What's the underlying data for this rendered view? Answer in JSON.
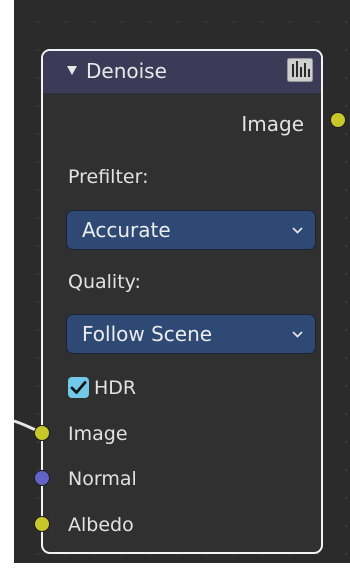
{
  "node": {
    "title": "Denoise",
    "collapse_icon": "triangle-down-icon",
    "preview_icon": "denoise-node-icon",
    "header_color": "#3b3a57",
    "border_color": "#f2f2f2",
    "outputs": [
      {
        "label": "Image",
        "socket_color": "#c7c729"
      }
    ],
    "prefilter": {
      "label": "Prefilter:",
      "value": "Accurate",
      "chevron_icon": "chevron-down-icon"
    },
    "quality": {
      "label": "Quality:",
      "value": "Follow Scene",
      "chevron_icon": "chevron-down-icon"
    },
    "hdr": {
      "label": "HDR",
      "checked": true,
      "check_color": "#72c8e8"
    },
    "inputs": [
      {
        "label": "Image",
        "socket_color": "#c7c729",
        "connected": true
      },
      {
        "label": "Normal",
        "socket_color": "#6363c7",
        "connected": false
      },
      {
        "label": "Albedo",
        "socket_color": "#c7c729",
        "connected": false
      }
    ]
  },
  "editor": {
    "background_color": "#2b2b2b",
    "dropdown_color": "#2e4a74"
  }
}
